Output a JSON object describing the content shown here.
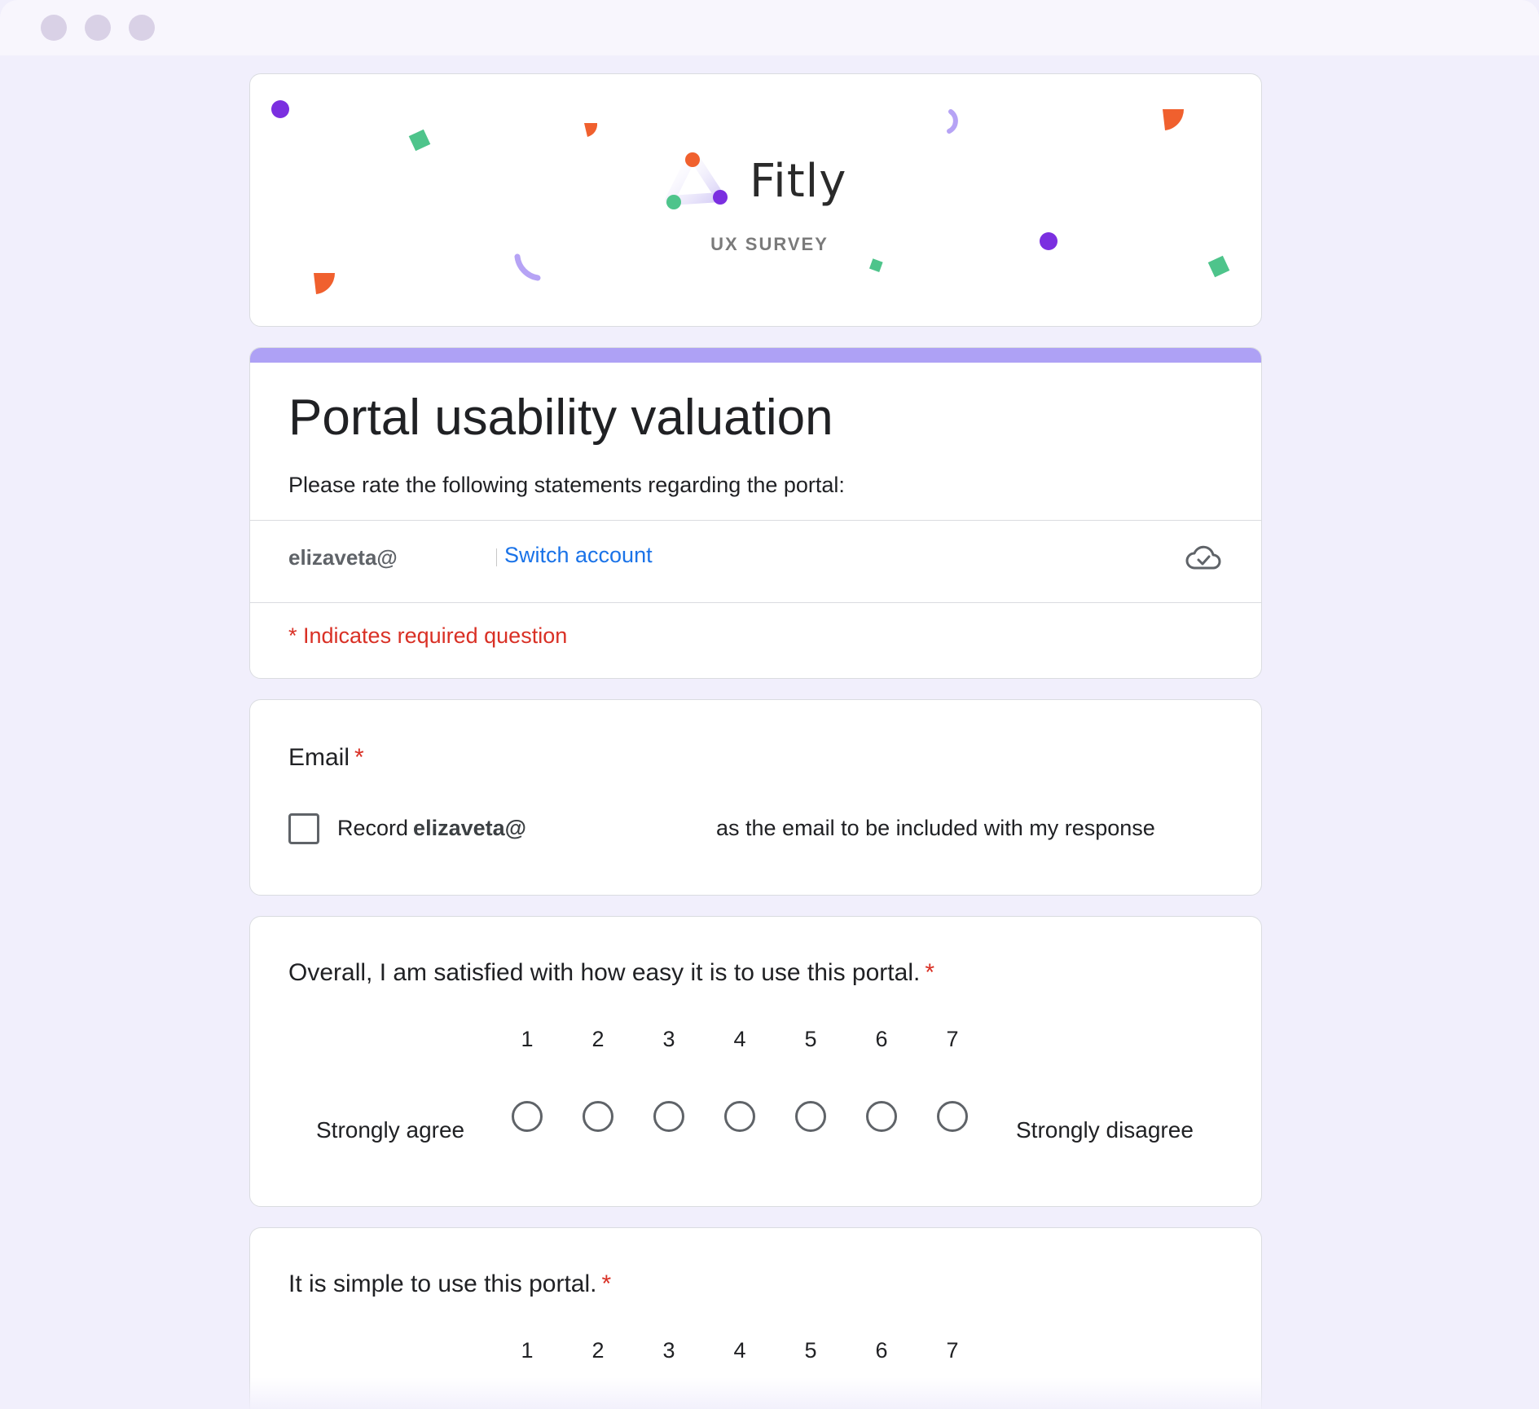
{
  "window": {
    "controls": [
      "traffic-dot",
      "traffic-dot",
      "traffic-dot"
    ]
  },
  "banner": {
    "brand": "Fitly",
    "subtitle": "UX SURVEY",
    "colors": {
      "purple": "#7b2fe0",
      "orange": "#f0602e",
      "green": "#4ec48b",
      "lavender": "#b6a3f5"
    }
  },
  "form": {
    "title": "Portal usability valuation",
    "description": "Please rate the following statements regarding the portal:",
    "account_email": "elizaveta@",
    "switch_account": "Switch account",
    "required_note": "* Indicates required question",
    "accent_color": "#aea1f5"
  },
  "email_question": {
    "title": "Email",
    "required_mark": "*",
    "record_prefix": "Record",
    "record_email": "elizaveta@",
    "record_suffix": "as the email to be included with my response",
    "checked": false
  },
  "questions": [
    {
      "title": "Overall, I am satisfied with how easy it is to use this portal.",
      "required_mark": "*",
      "scale": [
        "1",
        "2",
        "3",
        "4",
        "5",
        "6",
        "7"
      ],
      "low_label": "Strongly agree",
      "high_label": "Strongly disagree",
      "selected": null
    },
    {
      "title": "It is simple to use this portal.",
      "required_mark": "*",
      "scale": [
        "1",
        "2",
        "3",
        "4",
        "5",
        "6",
        "7"
      ],
      "selected": null
    }
  ]
}
